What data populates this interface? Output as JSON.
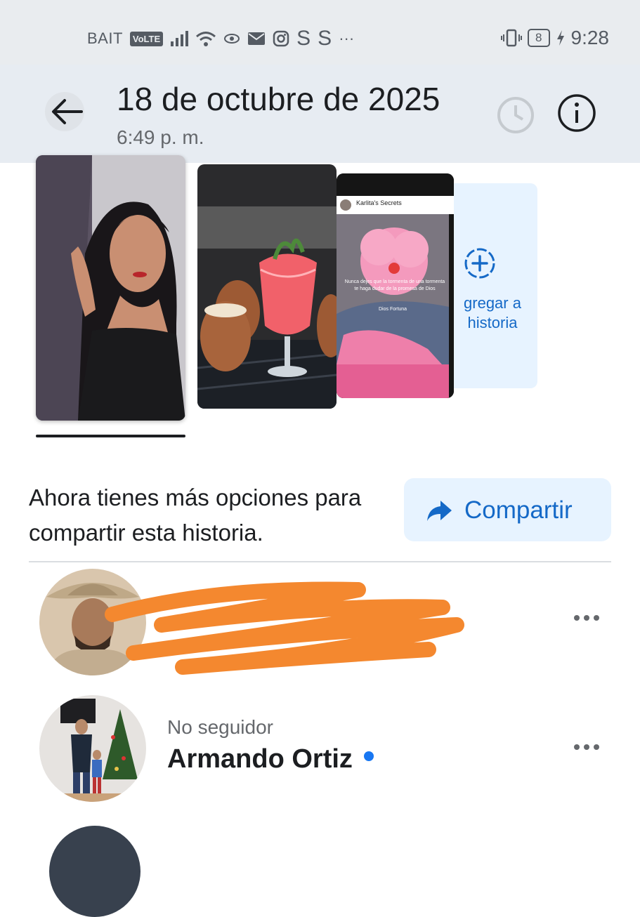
{
  "status_bar": {
    "carrier": "BAIT",
    "volte": "VoLTE",
    "battery": "8",
    "time": "9:28",
    "icons": [
      "signal-icon",
      "wifi-icon",
      "eye-icon",
      "mail-icon",
      "instagram-icon",
      "s-app-icon",
      "s-app-icon",
      "more-dots-icon",
      "vibrate-icon",
      "battery-icon",
      "charging-icon"
    ]
  },
  "header": {
    "title": "18 de octubre de 2025",
    "subtitle": "6:49 p. m."
  },
  "stories": [
    {
      "kind": "photo",
      "subject": "woman-portrait"
    },
    {
      "kind": "photo",
      "subject": "cocktails"
    },
    {
      "kind": "shared-post",
      "author": "Karlita's Secrets",
      "caption": "Nunca dejes que la tormenta de una tormenta te haga dudar de la promesa de Dios",
      "caption_sub": "Dios Fortuna"
    },
    {
      "kind": "add",
      "label": "gregar a historia"
    }
  ],
  "share_prompt": {
    "text": "Ahora tienes más opciones para compartir esta historia.",
    "button_label": "Compartir"
  },
  "viewers": [
    {
      "name_redacted": true,
      "relation": "",
      "name": ""
    },
    {
      "relation": "No seguidor",
      "name": "Armando Ortiz",
      "online": true
    }
  ],
  "colors": {
    "accent": "#1569c7",
    "accent_bg": "#e7f3ff",
    "header_bg": "#e7ecf2",
    "status_bg": "#e9ecef",
    "redaction": "#f4882f",
    "online_dot": "#1877f2"
  }
}
